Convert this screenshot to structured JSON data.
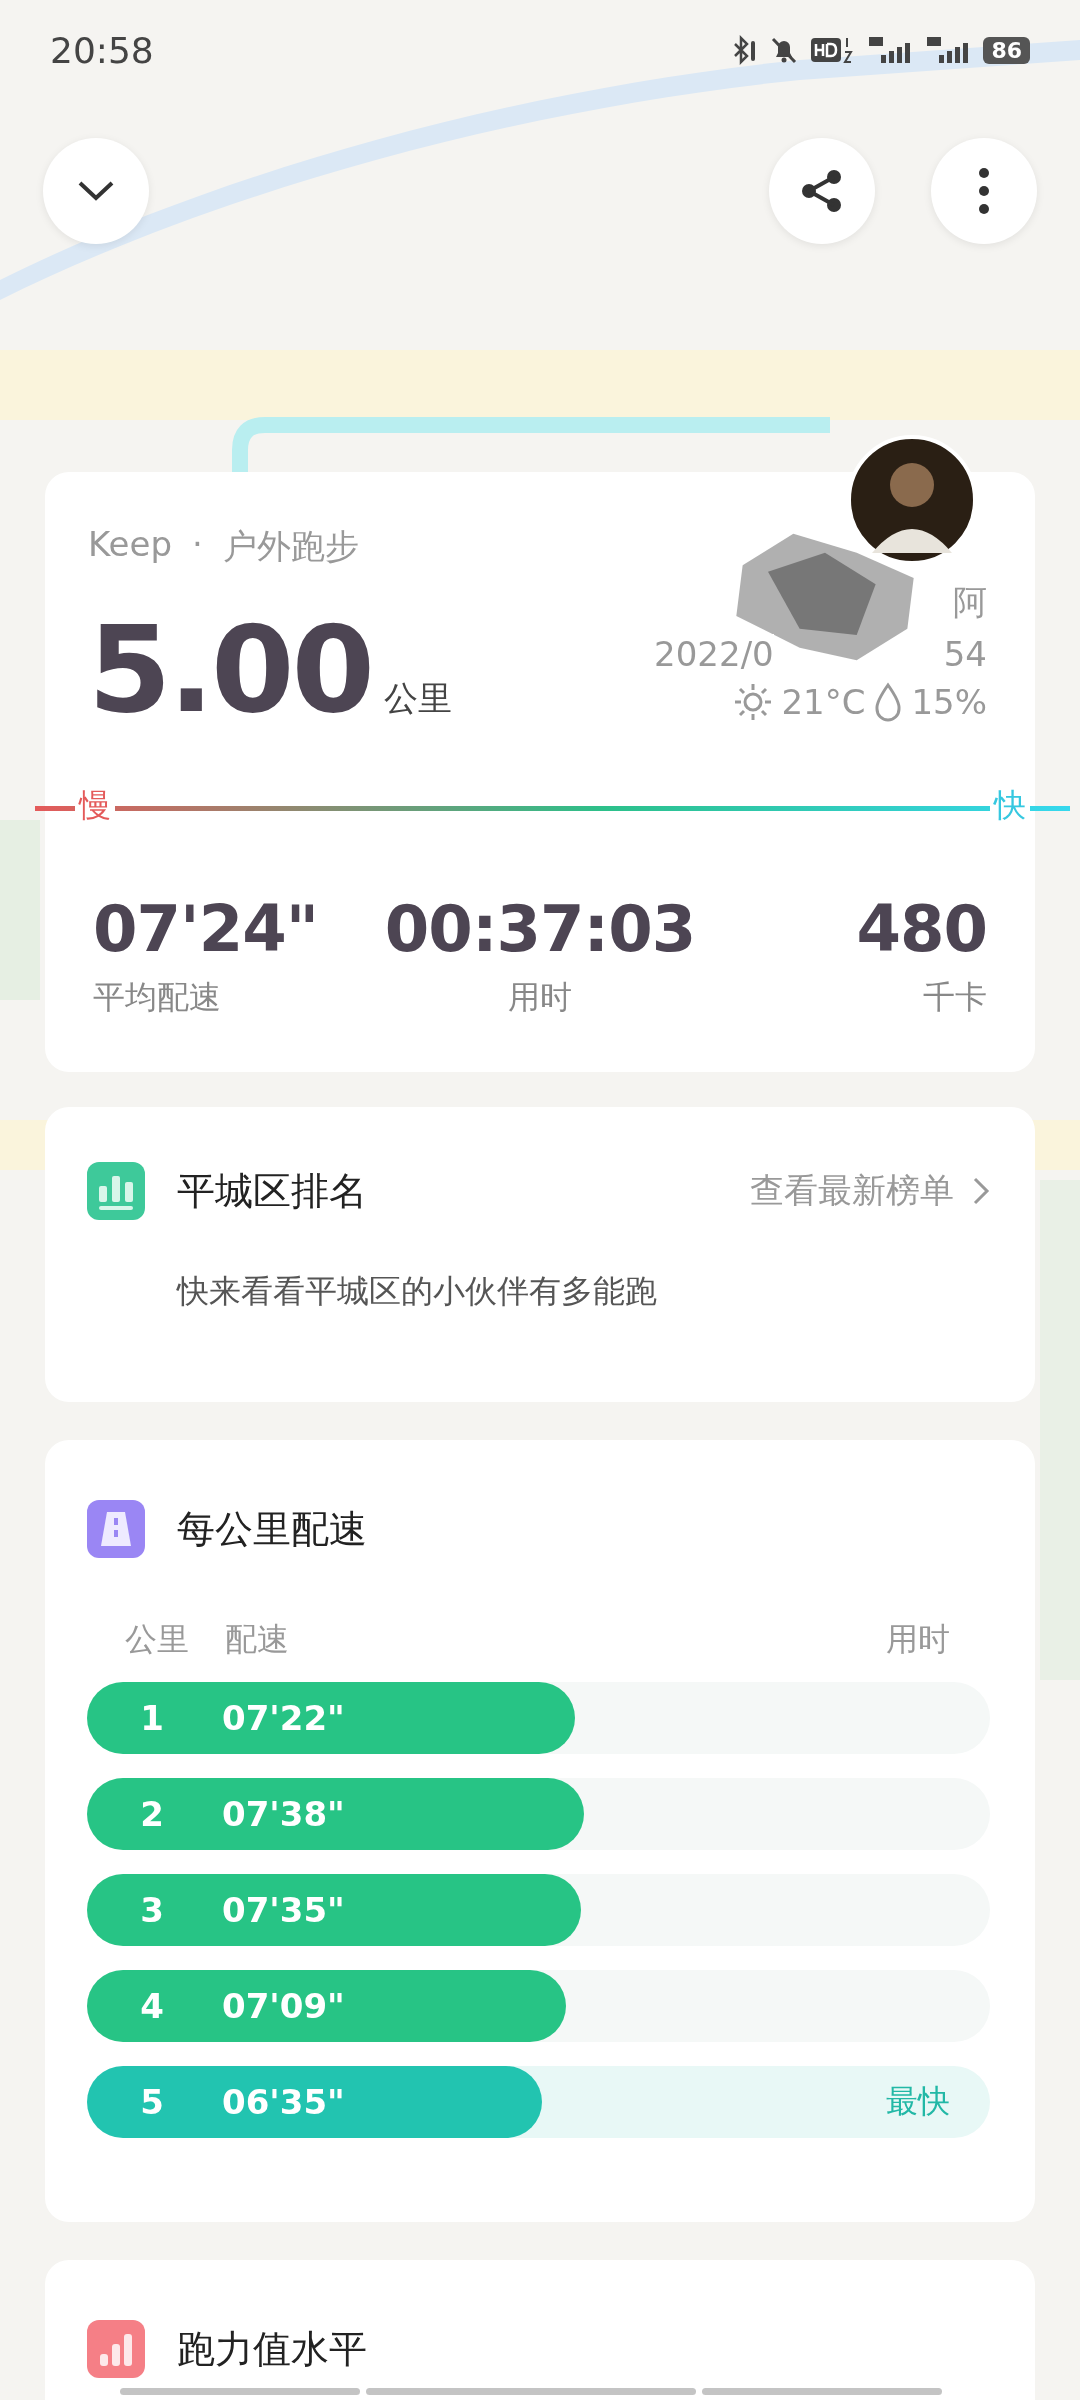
{
  "status_bar": {
    "time": "20:58",
    "battery": "86"
  },
  "summary": {
    "source": "Keep",
    "separator": "·",
    "sport": "户外跑步",
    "distance": "5.00",
    "distance_unit": "公里",
    "name_tail": "阿",
    "date_start": "2022/0",
    "date_end": "54",
    "temperature": "21°C",
    "humidity": "15%",
    "slow_label": "慢",
    "fast_label": "快",
    "stats": [
      {
        "value": "07'24\"",
        "label": "平均配速"
      },
      {
        "value": "00:37:03",
        "label": "用时"
      },
      {
        "value": "480",
        "label": "千卡"
      }
    ]
  },
  "ranking": {
    "title": "平城区排名",
    "link": "查看最新榜单",
    "message": "快来看看平城区的小伙伴有多能跑"
  },
  "splits": {
    "title": "每公里配速",
    "columns": [
      "公里",
      "配速",
      "用时"
    ],
    "rows": [
      {
        "km": "1",
        "pace": "07'22\"",
        "level": 0.54,
        "fastest": false
      },
      {
        "km": "2",
        "pace": "07'38\"",
        "level": 0.55,
        "fastest": false
      },
      {
        "km": "3",
        "pace": "07'35\"",
        "level": 0.547,
        "fastest": false
      },
      {
        "km": "4",
        "pace": "07'09\"",
        "level": 0.53,
        "fastest": false
      },
      {
        "km": "5",
        "pace": "06'35\"",
        "level": 0.504,
        "fastest": true,
        "badge": "最快"
      }
    ]
  },
  "running_level": {
    "title": "跑力值水平"
  }
}
